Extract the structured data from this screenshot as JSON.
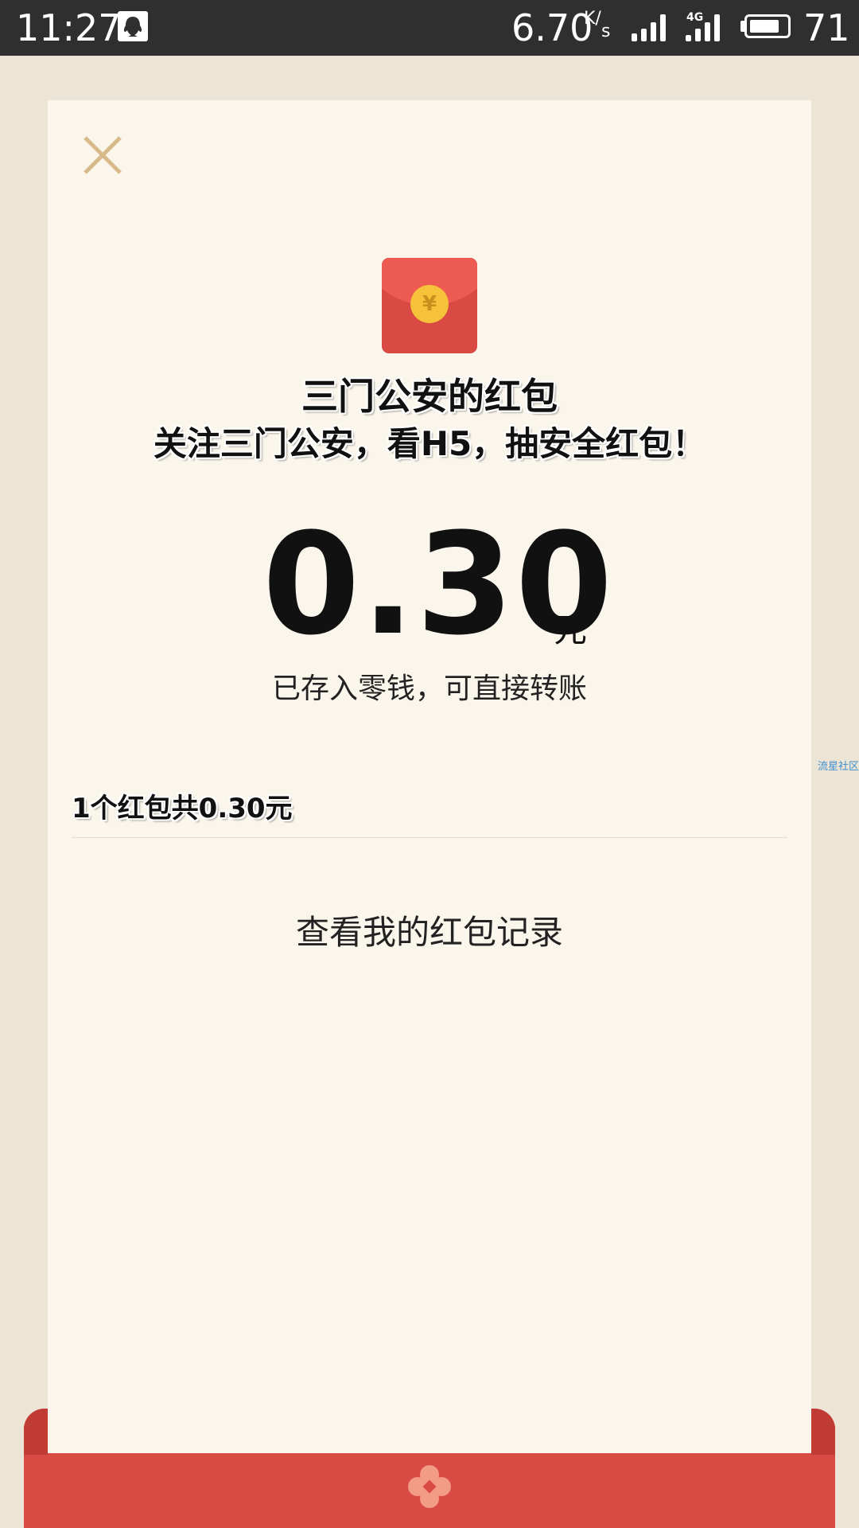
{
  "status_bar": {
    "time": "11:27",
    "network_speed": "6.70",
    "speed_unit_top": "K/",
    "speed_unit_bottom": "s",
    "network_type": "4G",
    "battery_level": "71"
  },
  "packet": {
    "sender_title": "三门公安的红包",
    "greeting": "关注三门公安，看H5，抽安全红包！",
    "amount": "0.30",
    "amount_unit": "元",
    "saved_note": "已存入零钱，可直接转账",
    "summary": "1个红包共0.30元",
    "records_link": "查看我的红包记录",
    "coin_symbol": "¥"
  },
  "watermark": "流星社区",
  "colors": {
    "background": "#ece5d6",
    "card": "#faf6ec",
    "envelope_red": "#d94a43",
    "coin_gold": "#f5c23a",
    "close_icon": "#d7b98a"
  }
}
